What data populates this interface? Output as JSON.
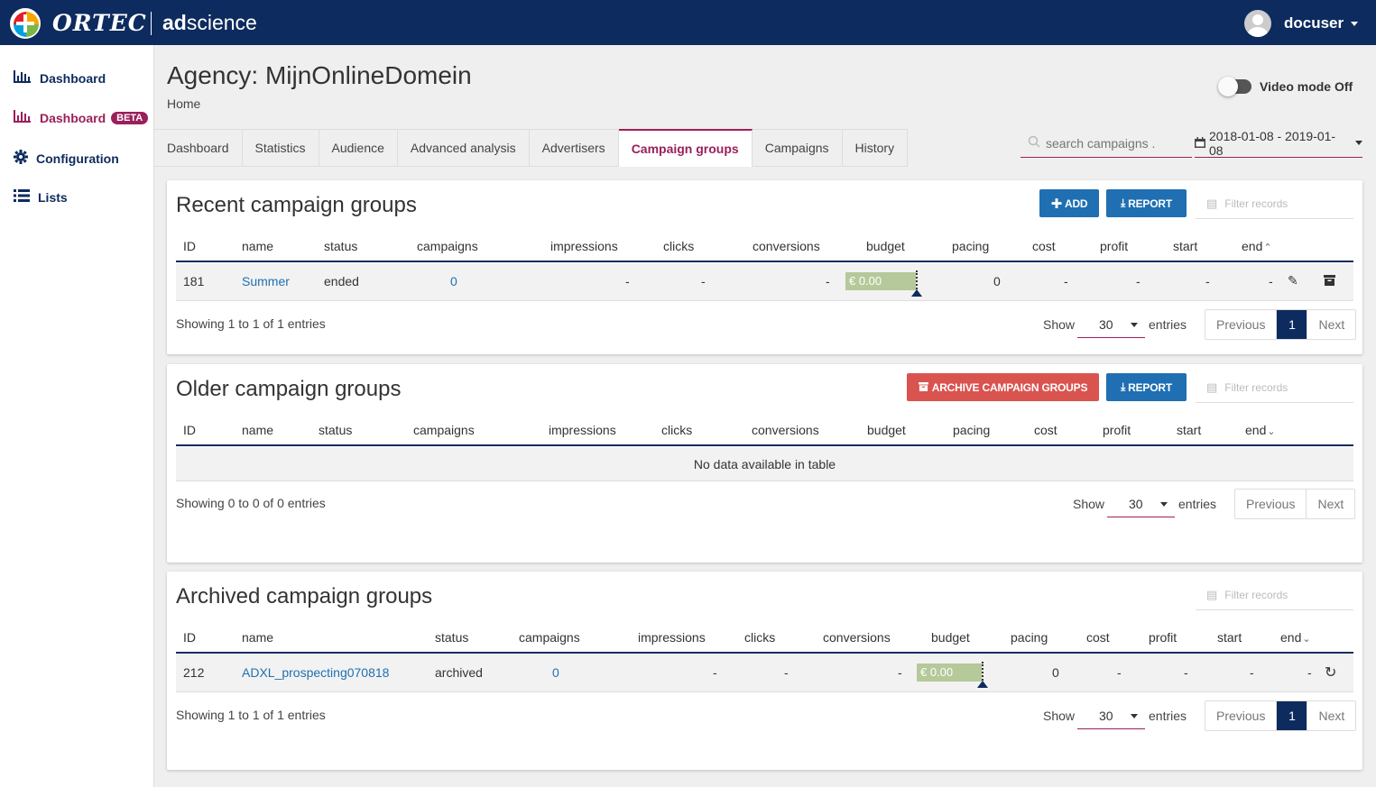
{
  "header": {
    "brand": "ORTEC",
    "product": "adscience",
    "user": "docuser"
  },
  "sidebar": {
    "items": [
      {
        "label": "Dashboard",
        "icon": "bar-chart-icon"
      },
      {
        "label": "Dashboard",
        "badge": "BETA",
        "icon": "bar-chart-icon"
      },
      {
        "label": "Configuration",
        "icon": "gear-icon"
      },
      {
        "label": "Lists",
        "icon": "list-icon"
      }
    ]
  },
  "page": {
    "title": "Agency: MijnOnlineDomein",
    "breadcrumb": "Home",
    "video_mode": "Video mode Off"
  },
  "tabs": [
    "Dashboard",
    "Statistics",
    "Audience",
    "Advanced analysis",
    "Advertisers",
    "Campaign groups",
    "Campaigns",
    "History"
  ],
  "active_tab": "Campaign groups",
  "search": {
    "placeholder": "search campaigns ."
  },
  "daterange": "2018-01-08 - 2019-01-08",
  "colors": {
    "navy": "#0d2b5e",
    "accent": "#9b1f5a",
    "blue": "#1f6fb2",
    "red": "#d9534f",
    "budget": "#b5c99a"
  },
  "columns": [
    "ID",
    "name",
    "status",
    "campaigns",
    "impressions",
    "clicks",
    "conversions",
    "budget",
    "pacing",
    "cost",
    "profit",
    "start",
    "end"
  ],
  "recent": {
    "title": "Recent campaign groups",
    "add": "ADD",
    "report": "REPORT",
    "filter": "Filter records",
    "row": {
      "id": "181",
      "name": "Summer",
      "status": "ended",
      "campaigns": "0",
      "impressions": "-",
      "clicks": "-",
      "conversions": "-",
      "budget": "€ 0.00",
      "pacing": "0",
      "cost": "-",
      "profit": "-",
      "start": "-",
      "end": "-"
    },
    "info": "Showing 1 to 1 of 1 entries",
    "page": "1"
  },
  "older": {
    "title": "Older campaign groups",
    "archive": "ARCHIVE CAMPAIGN GROUPS",
    "report": "REPORT",
    "filter": "Filter records",
    "empty": "No data available in table",
    "info": "Showing 0 to 0 of 0 entries"
  },
  "archived": {
    "title": "Archived campaign groups",
    "filter": "Filter records",
    "row": {
      "id": "212",
      "name": "ADXL_prospecting070818",
      "status": "archived",
      "campaigns": "0",
      "impressions": "-",
      "clicks": "-",
      "conversions": "-",
      "budget": "€ 0.00",
      "pacing": "0",
      "cost": "-",
      "profit": "-",
      "start": "-",
      "end": "-"
    },
    "info": "Showing 1 to 1 of 1 entries",
    "page": "1"
  },
  "paging": {
    "show": "Show",
    "entries": "entries",
    "length": "30",
    "previous": "Previous",
    "next": "Next"
  }
}
